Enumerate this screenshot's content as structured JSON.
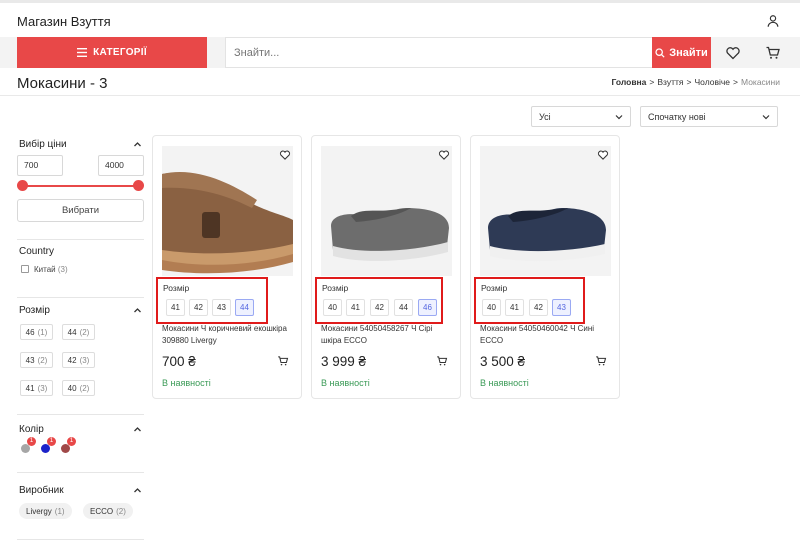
{
  "header": {
    "site_name": "Магазин Взуття"
  },
  "nav": {
    "categories_label": "КАТЕГОРІЇ",
    "search_placeholder": "Знайти...",
    "search_button": "Знайти"
  },
  "page": {
    "title": "Мокасини - 3"
  },
  "breadcrumb": [
    "Головна",
    "Взуття",
    "Чоловіче",
    "Мокасини"
  ],
  "toolbar": {
    "filter_value": "Усі",
    "sort_value": "Спочатку нові"
  },
  "filters": {
    "price": {
      "title": "Вибір ціни",
      "min": "700",
      "max": "4000",
      "apply_label": "Вибрати"
    },
    "country": {
      "title": "Country",
      "options": [
        {
          "label": "Китай",
          "count": "(3)"
        }
      ]
    },
    "size": {
      "title": "Розмір",
      "options": [
        {
          "label": "46",
          "count": "(1)"
        },
        {
          "label": "44",
          "count": "(2)"
        },
        {
          "label": "43",
          "count": "(2)"
        },
        {
          "label": "42",
          "count": "(3)"
        },
        {
          "label": "41",
          "count": "(3)"
        },
        {
          "label": "40",
          "count": "(2)"
        }
      ]
    },
    "color": {
      "title": "Колір",
      "swatches": [
        {
          "color": "#a6a6a6",
          "badge": "1"
        },
        {
          "color": "#1c22c9",
          "badge": "1"
        },
        {
          "color": "#a04848",
          "badge": "1"
        }
      ]
    },
    "maker": {
      "title": "Виробник",
      "options": [
        {
          "label": "Livergy",
          "count": "(1)"
        },
        {
          "label": "ECCO",
          "count": "(2)"
        }
      ]
    }
  },
  "products": [
    {
      "size_label": "Розмір",
      "sizes": [
        "41",
        "42",
        "43",
        "44"
      ],
      "selected_size": "44",
      "name": "Мокасини Ч коричневий екошкіра 309880 Livergy",
      "price": "700 ₴",
      "stock": "В наявності"
    },
    {
      "size_label": "Розмір",
      "sizes": [
        "40",
        "41",
        "42",
        "44",
        "46"
      ],
      "selected_size": "46",
      "name": "Мокасини 54050458267 Ч Сірі шкіра ECCO",
      "price": "3 999 ₴",
      "stock": "В наявності"
    },
    {
      "size_label": "Розмір",
      "sizes": [
        "40",
        "41",
        "42",
        "43"
      ],
      "selected_size": "43",
      "name": "Мокасини 54050460042 Ч Сині ECCO",
      "price": "3 500 ₴",
      "stock": "В наявності"
    }
  ],
  "colors": {
    "accent": "#e84848",
    "in_stock": "#3a9a56",
    "highlight_box": "#e01b1b"
  }
}
